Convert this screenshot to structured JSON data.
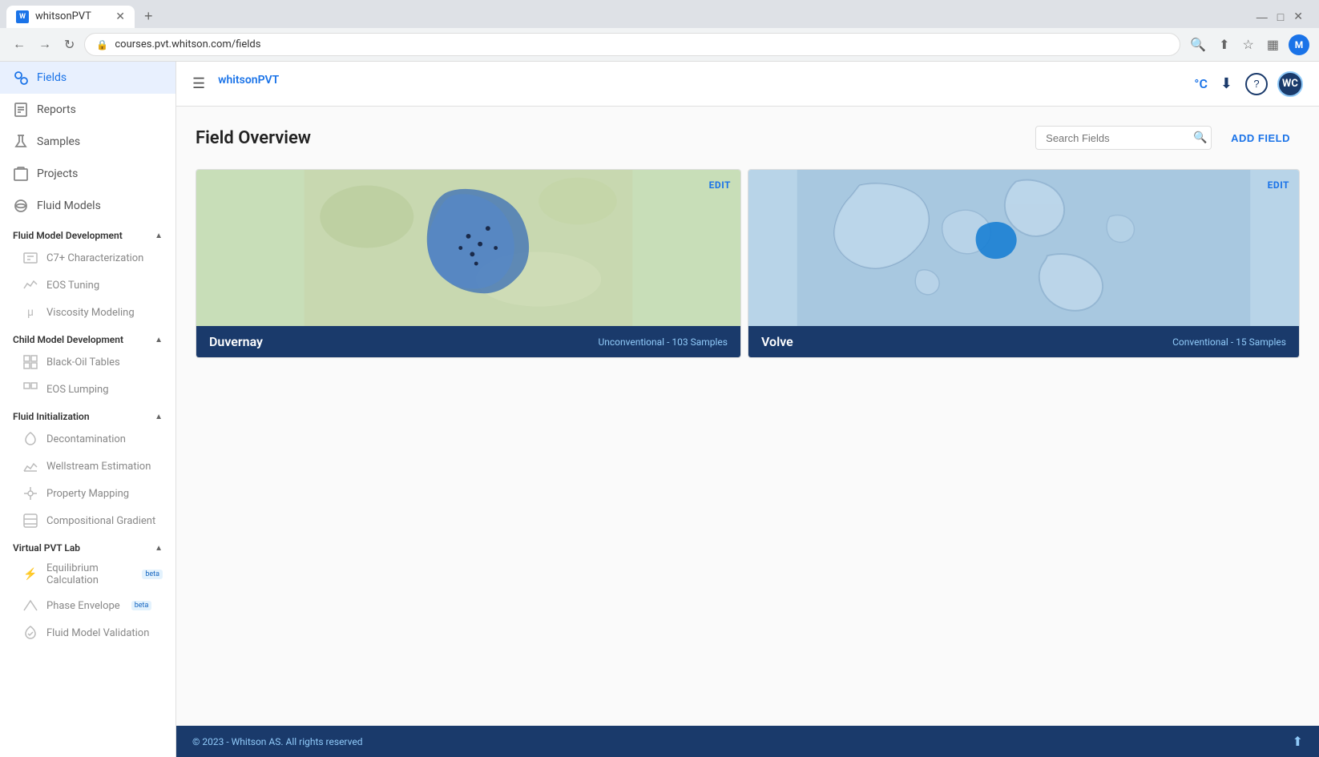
{
  "browser": {
    "tab_title": "whitsonPVT",
    "url": "courses.pvt.whitson.com/fields",
    "favicon_letter": "W"
  },
  "header": {
    "hamburger_label": "☰",
    "logo_text": "whitson",
    "logo_superscript": "PVT",
    "temp_unit": "°C",
    "download_icon": "⬇",
    "help_icon": "?",
    "user_initials": "WC"
  },
  "sidebar": {
    "nav_items": [
      {
        "id": "fields",
        "label": "Fields",
        "active": true
      },
      {
        "id": "reports",
        "label": "Reports",
        "active": false
      },
      {
        "id": "samples",
        "label": "Samples",
        "active": false
      },
      {
        "id": "projects",
        "label": "Projects",
        "active": false
      },
      {
        "id": "fluid-models",
        "label": "Fluid Models",
        "active": false
      }
    ],
    "sections": [
      {
        "id": "fluid-model-dev",
        "label": "Fluid Model Development",
        "expanded": true,
        "items": [
          {
            "id": "c7-char",
            "label": "C7+ Characterization"
          },
          {
            "id": "eos-tuning",
            "label": "EOS Tuning"
          },
          {
            "id": "viscosity",
            "label": "Viscosity Modeling"
          }
        ]
      },
      {
        "id": "child-model-dev",
        "label": "Child Model Development",
        "expanded": true,
        "items": [
          {
            "id": "black-oil",
            "label": "Black-Oil Tables"
          },
          {
            "id": "eos-lumping",
            "label": "EOS Lumping"
          }
        ]
      },
      {
        "id": "fluid-init",
        "label": "Fluid Initialization",
        "expanded": true,
        "items": [
          {
            "id": "decontamination",
            "label": "Decontamination"
          },
          {
            "id": "wellstream",
            "label": "Wellstream Estimation"
          },
          {
            "id": "property-mapping",
            "label": "Property Mapping"
          },
          {
            "id": "comp-gradient",
            "label": "Compositional Gradient"
          }
        ]
      },
      {
        "id": "virtual-pvt",
        "label": "Virtual PVT Lab",
        "expanded": true,
        "items": [
          {
            "id": "equilibrium",
            "label": "Equilibrium Calculation",
            "beta": true
          },
          {
            "id": "phase-envelope",
            "label": "Phase Envelope",
            "beta": true
          },
          {
            "id": "fluid-validation",
            "label": "Fluid Model Validation"
          }
        ]
      }
    ]
  },
  "content": {
    "page_title": "Field Overview",
    "search_placeholder": "Search Fields",
    "add_field_label": "ADD FIELD",
    "fields": [
      {
        "id": "duvernay",
        "name": "Duvernay",
        "type": "Unconventional",
        "sample_count": "103",
        "edit_label": "EDIT"
      },
      {
        "id": "volve",
        "name": "Volve",
        "type": "Conventional",
        "sample_count": "15",
        "edit_label": "EDIT"
      }
    ]
  },
  "footer": {
    "copyright": "© 2023 - Whitson AS. All rights reserved"
  }
}
